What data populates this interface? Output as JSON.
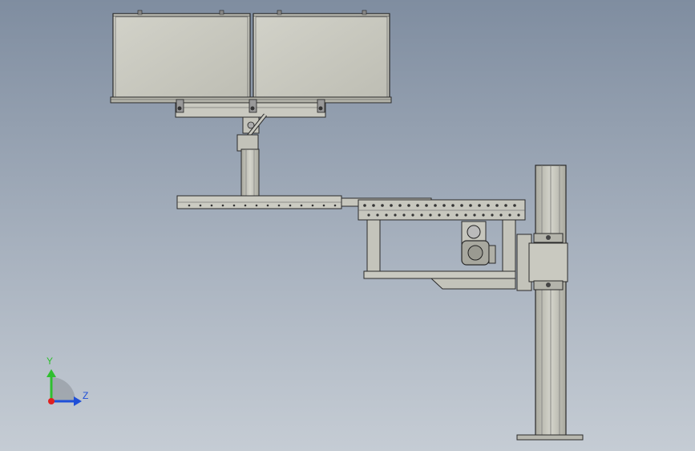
{
  "triad": {
    "y_label": "Y",
    "z_label": "Z",
    "y_color": "#2fbf2f",
    "z_color": "#1f4fd8",
    "x_color": "#e02020"
  },
  "model": {
    "part_color": "#c8c8bf",
    "panel_color": "#c6c6bd",
    "edge_color": "#2a2a2a",
    "rail_color": "#bcbcb2"
  }
}
